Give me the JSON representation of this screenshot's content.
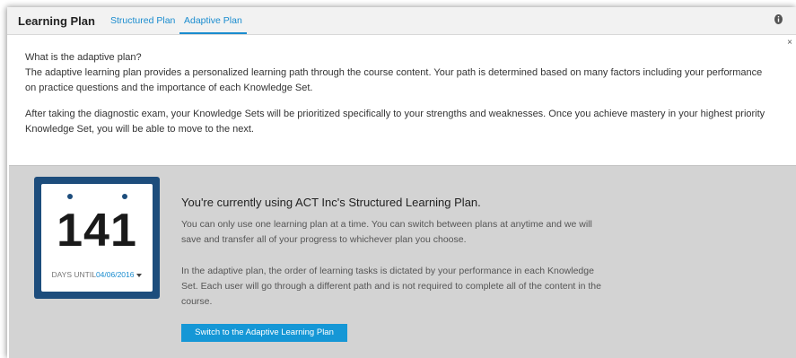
{
  "header": {
    "title": "Learning Plan",
    "tabs": [
      {
        "label": "Structured Plan"
      },
      {
        "label": "Adaptive Plan",
        "active": true
      }
    ],
    "info_icon": "info-icon",
    "close_label": "×"
  },
  "intro": {
    "question": "What is the adaptive plan?",
    "paragraph1": "The adaptive learning plan provides a personalized learning path through the course content. Your path is determined based on many factors including your performance on practice questions and the importance of each Knowledge Set.",
    "paragraph2": "After taking the diagnostic exam, your Knowledge Sets will be prioritized specifically to your strengths and weaknesses. Once you achieve mastery in your highest priority Knowledge Set, you will be able to move to the next."
  },
  "calendar": {
    "days": "141",
    "days_until_label": "DAYS UNTIL",
    "date": "04/06/2016"
  },
  "plan_info": {
    "heading": "You're currently using ACT Inc's Structured Learning Plan.",
    "text1": "You can only use one learning plan at a time. You can switch between plans at anytime and we will save and transfer all of your progress to whichever plan you choose.",
    "text2": "In the adaptive plan, the order of learning tasks is dictated by your performance in each Knowledge Set. Each user will go through a different path and is not required to complete all of the content in the course.",
    "button_label": "Switch to the Adaptive Learning Plan"
  },
  "colors": {
    "accent": "#1a8ccf",
    "button": "#1597d6",
    "calendar_frame": "#1d4d7c",
    "panel_bg": "#d3d3d3"
  }
}
